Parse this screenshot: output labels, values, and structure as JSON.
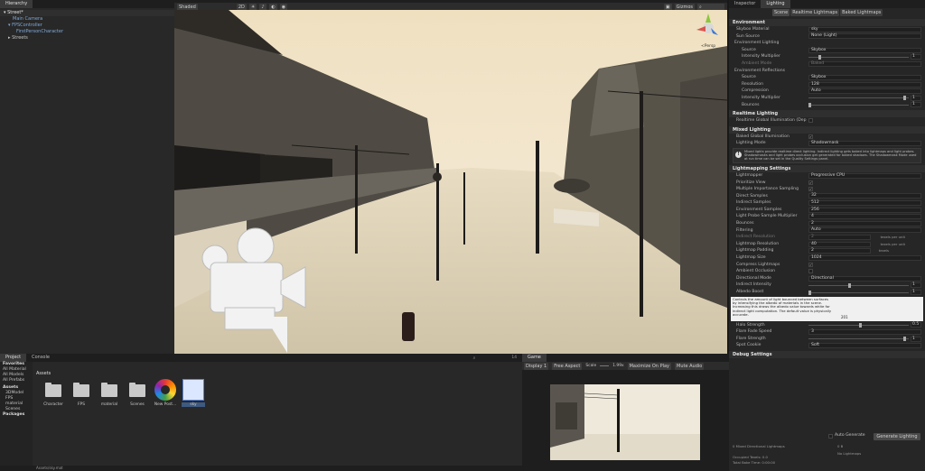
{
  "hierarchy": {
    "tab": "Hierarchy",
    "items": [
      {
        "label": "Street*",
        "indent": 0
      },
      {
        "label": "Main Camera",
        "indent": 2
      },
      {
        "label": "FPSController",
        "indent": 1
      },
      {
        "label": "FirstPersonCharacter",
        "indent": 2
      },
      {
        "label": "Streets",
        "indent": 1
      }
    ]
  },
  "scene": {
    "tab": "Scene",
    "shading": "Shaded",
    "mode_2d": "2D",
    "gizmos": "Gizmos",
    "persp_label": "<Persp"
  },
  "inspector": {
    "tabs": [
      "Inspector",
      "Lighting"
    ],
    "subtabs": [
      "Scene",
      "Realtime Lightmaps",
      "Baked Lightmaps"
    ],
    "environment": {
      "title": "Environment",
      "rows": [
        {
          "label": "Skybox Material",
          "value": "sky"
        },
        {
          "label": "Sun Source",
          "value": "None (Light)"
        }
      ],
      "lighting_title": "Environment Lighting",
      "lighting_rows": [
        {
          "label": "Source",
          "value": "Skybox"
        },
        {
          "label": "Intensity Multiplier",
          "value": "1"
        },
        {
          "label": "Ambient Mode",
          "value": "Baked"
        }
      ],
      "reflections_title": "Environment Reflections",
      "reflections_rows": [
        {
          "label": "Source",
          "value": "Skybox"
        },
        {
          "label": "Resolution",
          "value": "128"
        },
        {
          "label": "Compression",
          "value": "Auto"
        },
        {
          "label": "Intensity Multiplier",
          "value": "1"
        },
        {
          "label": "Bounces",
          "value": "1"
        }
      ]
    },
    "realtime": {
      "title": "Realtime Lighting",
      "row": "Realtime Global Illumination (Dep"
    },
    "mixed": {
      "title": "Mixed Lighting",
      "rows": [
        {
          "label": "Baked Global Illumination",
          "value": "✓"
        },
        {
          "label": "Lighting Mode",
          "value": "Shadowmask"
        }
      ],
      "info": "Mixed lights provide realtime direct lighting. Indirect lighting gets baked into lightmaps and light probes. Shadowmasks and light probes occlusion get generated for baked shadows. The Shadowmask Mode used at run time can be set in the Quality Settings panel."
    },
    "lightmapping": {
      "title": "Lightmapping Settings",
      "rows": [
        {
          "label": "Lightmapper",
          "value": "Progressive CPU"
        },
        {
          "label": "Prioritize View",
          "value": "✓"
        },
        {
          "label": "Multiple Importance Sampling",
          "value": "✓"
        },
        {
          "label": "Direct Samples",
          "value": "32"
        },
        {
          "label": "Indirect Samples",
          "value": "512"
        },
        {
          "label": "Environment Samples",
          "value": "256"
        },
        {
          "label": "Light Probe Sample Multiplier",
          "value": "4"
        },
        {
          "label": "Bounces",
          "value": "2"
        },
        {
          "label": "Filtering",
          "value": "Auto"
        },
        {
          "label": "Indirect Resolution",
          "value": "2"
        },
        {
          "label": "Lightmap Resolution",
          "value": "40"
        },
        {
          "label": "Lightmap Padding",
          "value": "2"
        },
        {
          "label": "Lightmap Size",
          "value": "1024"
        },
        {
          "label": "Compress Lightmaps",
          "value": "✓"
        },
        {
          "label": "Ambient Occlusion",
          "value": ""
        },
        {
          "label": "Directional Mode",
          "value": "Directional"
        },
        {
          "label": "Indirect Intensity",
          "value": "1"
        },
        {
          "label": "Albedo Boost",
          "value": "1"
        }
      ],
      "texel_per_unit": "texels per unit",
      "texels": "texels",
      "tooltip": "Controls the amount of light bounced between surfaces by intensifying the albedo of materials in the scene. Increasing this draws the albedo value towards white for indirect light computation. The default value is physically accurate.",
      "tooltip_value": "201",
      "extra_rows": [
        {
          "label": "Halo Strength",
          "value": "0.5"
        },
        {
          "label": "Flare Fade Speed",
          "value": "3"
        },
        {
          "label": "Flare Strength",
          "value": "1"
        },
        {
          "label": "Spot Cookie",
          "value": "Soft"
        }
      ]
    },
    "debug_title": "Debug Settings",
    "auto_generate": "Auto Generate",
    "generate_button": "Generate Lighting",
    "footer": [
      "0 Mixed Directional Lightmaps",
      "0 B",
      "No Lightmaps",
      "Occupied Texels: 0.0",
      "Total Bake Time: 0:00:00"
    ]
  },
  "project": {
    "tabs": [
      "Project",
      "Console"
    ],
    "favorites_title": "Favorites",
    "favorites": [
      "All Material",
      "All Models",
      "All Prefabs"
    ],
    "assets_title": "Assets",
    "assets_tree": [
      "3DModel",
      "FPS",
      "material",
      "Scenes"
    ],
    "packages_title": "Packages",
    "breadcrumb": "Assets",
    "assets": [
      {
        "label": "Character",
        "type": "folder"
      },
      {
        "label": "FPS",
        "type": "folder"
      },
      {
        "label": "material",
        "type": "folder"
      },
      {
        "label": "Scenes",
        "type": "folder"
      },
      {
        "label": "New Post...",
        "type": "profile"
      },
      {
        "label": "sky",
        "type": "material"
      }
    ],
    "status_file": "Assets/sky.mat",
    "count": "14"
  },
  "game": {
    "tab": "Game",
    "display": "Display 1",
    "aspect": "Free Aspect",
    "scale_label": "Scale",
    "scale_value": "1.99x",
    "maximize": "Maximize On Play",
    "mute": "Mute Audio"
  },
  "colors": {
    "sky": "#efe4cc",
    "ground": "#d9cdb4",
    "buildings": "#5f5b52",
    "accent": "#3d5a80"
  }
}
